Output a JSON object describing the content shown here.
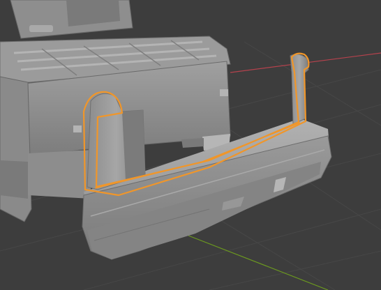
{
  "viewport": {
    "background_color": "#3d3d3d",
    "grid_color": "#474747",
    "x_axis_color": "#b5424d",
    "y_axis_color": "#6c9a1f",
    "selection_outline_color": "#f0962a"
  },
  "scene": {
    "object_kind": "truck rear bumper mesh (selected) and truck body",
    "mesh_shade_light": "#a4a4a4",
    "mesh_shade_mid": "#8f8f8f",
    "mesh_shade_dark": "#6e6e6e"
  }
}
